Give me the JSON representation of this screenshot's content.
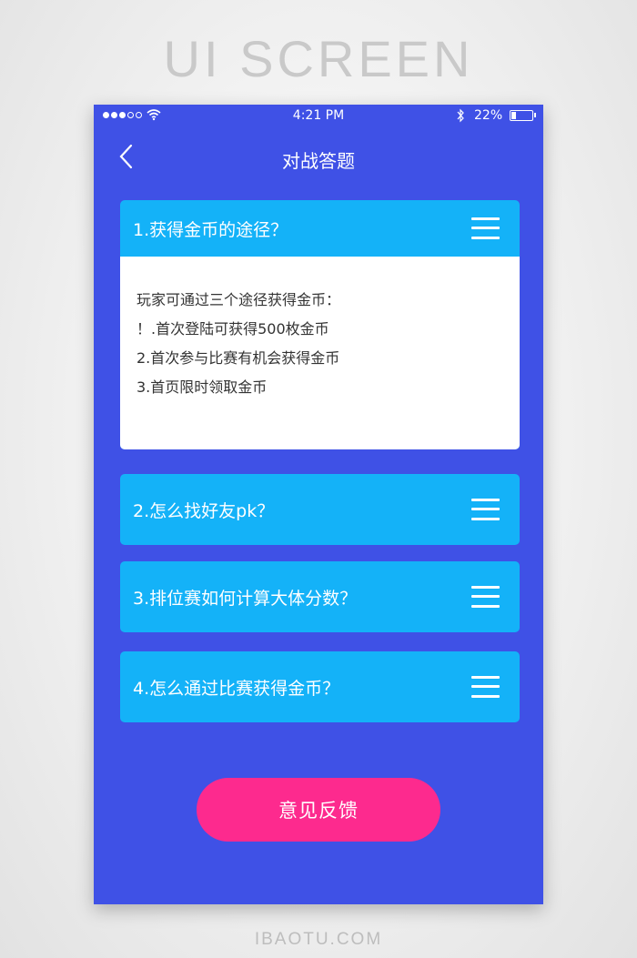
{
  "banner": {
    "headline": "UI SCREEN",
    "footer": "IBAOTU.COM"
  },
  "status_bar": {
    "time": "4:21 PM",
    "battery": "22%",
    "battery_level": 0.22,
    "signal_bars_filled": 3,
    "signal_bars_total": 5
  },
  "nav": {
    "title": "对战答题",
    "back_icon": "chevron-left-icon"
  },
  "faq": [
    {
      "question": "1.获得金币的途径？",
      "expanded": true,
      "answer": [
        "玩家可通过三个途径获得金币：",
        "！.首次登陆可获得500枚金币",
        "2.首次参与比赛有机会获得金币",
        "3.首页限时领取金币"
      ]
    },
    {
      "question": "2.怎么找好友pk？",
      "expanded": false
    },
    {
      "question": "3.排位赛如何计算大体分数？",
      "expanded": false
    },
    {
      "question": "4.怎么通过比赛获得金币？",
      "expanded": false
    }
  ],
  "feedback_button": "意见反馈",
  "colors": {
    "background": "#3f51e6",
    "card": "#14b2f8",
    "accent": "#fd2a8e",
    "answer_bg": "#ffffff"
  },
  "icons": {
    "menu": "hamburger-menu-icon",
    "wifi": "wifi-icon",
    "bluetooth": "bluetooth-icon",
    "battery": "battery-icon"
  }
}
